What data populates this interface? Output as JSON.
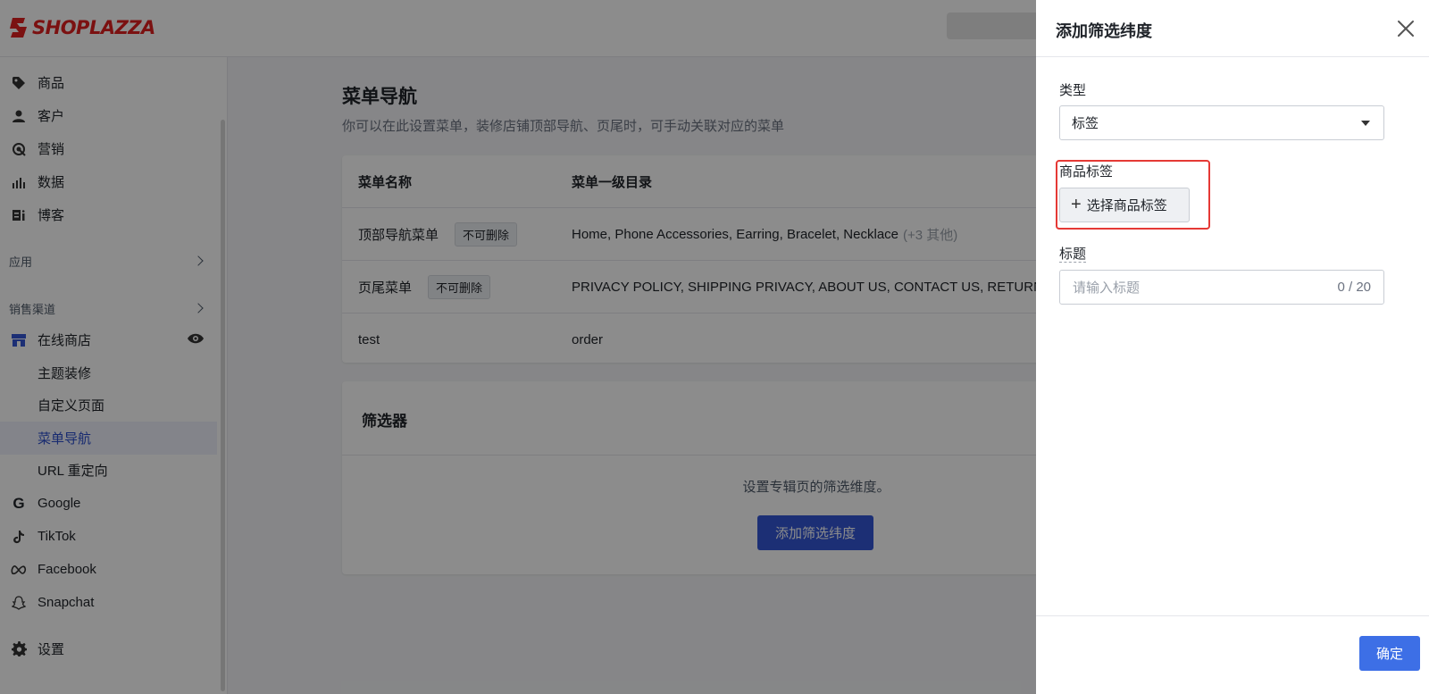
{
  "header": {
    "logo_text": "SHOPLAZZA",
    "brand_color": "#e02020"
  },
  "sidebar": {
    "items": [
      {
        "label": "商品",
        "icon": "tag-icon"
      },
      {
        "label": "客户",
        "icon": "person-icon"
      },
      {
        "label": "营销",
        "icon": "marketing-icon"
      },
      {
        "label": "数据",
        "icon": "bar-chart-icon"
      },
      {
        "label": "博客",
        "icon": "blog-icon"
      }
    ],
    "apps_label": "应用",
    "channels_label": "销售渠道",
    "online_store": {
      "label": "在线商店",
      "icon": "store-icon",
      "eye_icon": "eye-icon"
    },
    "sub_items": [
      "主题装修",
      "自定义页面",
      "菜单导航",
      "URL 重定向"
    ],
    "active_sub": "菜单导航",
    "channels": [
      {
        "label": "Google",
        "icon": "google-icon"
      },
      {
        "label": "TikTok",
        "icon": "tiktok-icon"
      },
      {
        "label": "Facebook",
        "icon": "meta-icon"
      },
      {
        "label": "Snapchat",
        "icon": "snapchat-icon"
      }
    ],
    "settings": {
      "label": "设置",
      "icon": "gear-icon"
    }
  },
  "main": {
    "title": "菜单导航",
    "subtitle": "你可以在此设置菜单，装修店铺顶部导航、页尾时，可手动关联对应的菜单",
    "table": {
      "headers": [
        "菜单名称",
        "菜单一级目录"
      ],
      "rows": [
        {
          "name": "顶部导航菜单",
          "tag": "不可删除",
          "items": "Home, Phone Accessories, Earring, Bracelet, Necklace",
          "more": "(+3 其他)"
        },
        {
          "name": "页尾菜单",
          "tag": "不可删除",
          "items": "PRIVACY POLICY, SHIPPING PRIVACY, ABOUT US, CONTACT US, RETURN",
          "more": ""
        },
        {
          "name": "test",
          "tag": "",
          "items": "order",
          "more": ""
        }
      ]
    },
    "filter": {
      "title": "筛选器",
      "description": "设置专辑页的筛选维度。",
      "add_button": "添加筛选纬度"
    }
  },
  "drawer": {
    "title": "添加筛选纬度",
    "type_label": "类型",
    "type_value": "标签",
    "product_tag_label": "商品标签",
    "choose_button": "选择商品标签",
    "title_label": "标题",
    "title_placeholder": "请输入标题",
    "title_counter": "0 / 20",
    "confirm_button": "确定"
  }
}
